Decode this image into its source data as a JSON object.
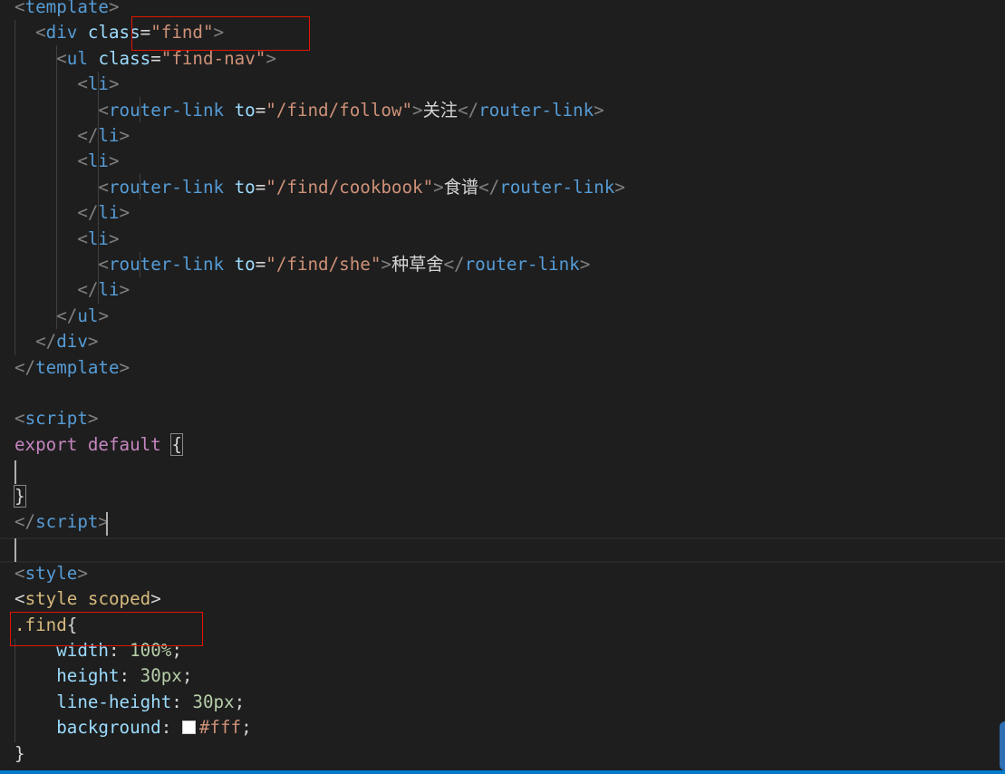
{
  "editor": {
    "language": "vue",
    "theme_colors": {
      "background": "#1e1e1e",
      "tag": "#569cd6",
      "attribute": "#9cdcfe",
      "string": "#ce9178",
      "keyword": "#c586c0",
      "selector": "#d7ba7d",
      "number": "#b5cea8",
      "highlight_box": "#e51400",
      "status_bar": "#007acc"
    },
    "lines": [
      {
        "segments": [
          {
            "t": "<",
            "c": "bracket"
          },
          {
            "t": "template",
            "c": "tag"
          },
          {
            "t": ">",
            "c": "bracket"
          }
        ]
      },
      {
        "segments": [
          {
            "t": "  "
          },
          {
            "t": "<",
            "c": "bracket"
          },
          {
            "t": "div",
            "c": "tag"
          },
          {
            "t": " "
          },
          {
            "t": "class",
            "c": "attr"
          },
          {
            "t": "=",
            "c": "text"
          },
          {
            "t": "\"find\"",
            "c": "str"
          },
          {
            "t": ">",
            "c": "bracket"
          }
        ]
      },
      {
        "segments": [
          {
            "t": "    "
          },
          {
            "t": "<",
            "c": "bracket"
          },
          {
            "t": "ul",
            "c": "tag"
          },
          {
            "t": " "
          },
          {
            "t": "class",
            "c": "attr"
          },
          {
            "t": "=",
            "c": "text"
          },
          {
            "t": "\"find-nav\"",
            "c": "str"
          },
          {
            "t": ">",
            "c": "bracket"
          }
        ]
      },
      {
        "segments": [
          {
            "t": "      "
          },
          {
            "t": "<",
            "c": "bracket"
          },
          {
            "t": "li",
            "c": "tag"
          },
          {
            "t": ">",
            "c": "bracket"
          }
        ]
      },
      {
        "segments": [
          {
            "t": "        "
          },
          {
            "t": "<",
            "c": "bracket"
          },
          {
            "t": "router-link",
            "c": "tag"
          },
          {
            "t": " "
          },
          {
            "t": "to",
            "c": "attr"
          },
          {
            "t": "=",
            "c": "text"
          },
          {
            "t": "\"/find/follow\"",
            "c": "str"
          },
          {
            "t": ">",
            "c": "bracket"
          },
          {
            "t": "关注",
            "c": "text"
          },
          {
            "t": "</",
            "c": "bracket"
          },
          {
            "t": "router-link",
            "c": "tag"
          },
          {
            "t": ">",
            "c": "bracket"
          }
        ]
      },
      {
        "segments": [
          {
            "t": "      "
          },
          {
            "t": "</",
            "c": "bracket"
          },
          {
            "t": "li",
            "c": "tag"
          },
          {
            "t": ">",
            "c": "bracket"
          }
        ]
      },
      {
        "segments": [
          {
            "t": "      "
          },
          {
            "t": "<",
            "c": "bracket"
          },
          {
            "t": "li",
            "c": "tag"
          },
          {
            "t": ">",
            "c": "bracket"
          }
        ]
      },
      {
        "segments": [
          {
            "t": "        "
          },
          {
            "t": "<",
            "c": "bracket"
          },
          {
            "t": "router-link",
            "c": "tag"
          },
          {
            "t": " "
          },
          {
            "t": "to",
            "c": "attr"
          },
          {
            "t": "=",
            "c": "text"
          },
          {
            "t": "\"/find/cookbook\"",
            "c": "str"
          },
          {
            "t": ">",
            "c": "bracket"
          },
          {
            "t": "食谱",
            "c": "text"
          },
          {
            "t": "</",
            "c": "bracket"
          },
          {
            "t": "router-link",
            "c": "tag"
          },
          {
            "t": ">",
            "c": "bracket"
          }
        ]
      },
      {
        "segments": [
          {
            "t": "      "
          },
          {
            "t": "</",
            "c": "bracket"
          },
          {
            "t": "li",
            "c": "tag"
          },
          {
            "t": ">",
            "c": "bracket"
          }
        ]
      },
      {
        "segments": [
          {
            "t": "      "
          },
          {
            "t": "<",
            "c": "bracket"
          },
          {
            "t": "li",
            "c": "tag"
          },
          {
            "t": ">",
            "c": "bracket"
          }
        ]
      },
      {
        "segments": [
          {
            "t": "        "
          },
          {
            "t": "<",
            "c": "bracket"
          },
          {
            "t": "router-link",
            "c": "tag"
          },
          {
            "t": " "
          },
          {
            "t": "to",
            "c": "attr"
          },
          {
            "t": "=",
            "c": "text"
          },
          {
            "t": "\"/find/she\"",
            "c": "str"
          },
          {
            "t": ">",
            "c": "bracket"
          },
          {
            "t": "种草舍",
            "c": "text"
          },
          {
            "t": "</",
            "c": "bracket"
          },
          {
            "t": "router-link",
            "c": "tag"
          },
          {
            "t": ">",
            "c": "bracket"
          }
        ]
      },
      {
        "segments": [
          {
            "t": "      "
          },
          {
            "t": "</",
            "c": "bracket"
          },
          {
            "t": "li",
            "c": "tag"
          },
          {
            "t": ">",
            "c": "bracket"
          }
        ]
      },
      {
        "segments": [
          {
            "t": "    "
          },
          {
            "t": "</",
            "c": "bracket"
          },
          {
            "t": "ul",
            "c": "tag"
          },
          {
            "t": ">",
            "c": "bracket"
          }
        ]
      },
      {
        "segments": [
          {
            "t": "  "
          },
          {
            "t": "</",
            "c": "bracket"
          },
          {
            "t": "div",
            "c": "tag"
          },
          {
            "t": ">",
            "c": "bracket"
          }
        ]
      },
      {
        "segments": [
          {
            "t": "</",
            "c": "bracket"
          },
          {
            "t": "template",
            "c": "tag"
          },
          {
            "t": ">",
            "c": "bracket"
          }
        ]
      },
      {
        "segments": []
      },
      {
        "segments": [
          {
            "t": "<",
            "c": "bracket"
          },
          {
            "t": "script",
            "c": "tag"
          },
          {
            "t": ">",
            "c": "bracket"
          }
        ]
      },
      {
        "segments": [
          {
            "t": "export",
            "c": "kw"
          },
          {
            "t": " "
          },
          {
            "t": "default",
            "c": "kw"
          },
          {
            "t": " "
          },
          {
            "t": "{",
            "c": "text",
            "box": true
          }
        ]
      },
      {
        "segments": []
      },
      {
        "segments": [
          {
            "t": "}",
            "c": "text",
            "box": true
          }
        ]
      },
      {
        "segments": [
          {
            "t": "</",
            "c": "bracket"
          },
          {
            "t": "script",
            "c": "tag"
          },
          {
            "t": ">",
            "c": "bracket"
          }
        ]
      },
      {
        "segments": []
      },
      {
        "segments": [
          {
            "t": "<",
            "c": "bracket"
          },
          {
            "t": "style",
            "c": "tag"
          },
          {
            "t": ">",
            "c": "bracket"
          }
        ]
      },
      {
        "segments": [
          {
            "t": "<",
            "c": "text"
          },
          {
            "t": "style",
            "c": "sel"
          },
          {
            "t": " "
          },
          {
            "t": "scoped",
            "c": "sel"
          },
          {
            "t": ">",
            "c": "text"
          }
        ]
      },
      {
        "segments": [
          {
            "t": ".find",
            "c": "sel"
          },
          {
            "t": "{",
            "c": "text"
          }
        ]
      },
      {
        "segments": [
          {
            "t": "    "
          },
          {
            "t": "width",
            "c": "prop"
          },
          {
            "t": ": ",
            "c": "text"
          },
          {
            "t": "100%",
            "c": "num"
          },
          {
            "t": ";",
            "c": "text"
          }
        ]
      },
      {
        "segments": [
          {
            "t": "    "
          },
          {
            "t": "height",
            "c": "prop"
          },
          {
            "t": ": ",
            "c": "text"
          },
          {
            "t": "30px",
            "c": "num"
          },
          {
            "t": ";",
            "c": "text"
          }
        ]
      },
      {
        "segments": [
          {
            "t": "    "
          },
          {
            "t": "line-height",
            "c": "prop"
          },
          {
            "t": ": ",
            "c": "text"
          },
          {
            "t": "30px",
            "c": "num"
          },
          {
            "t": ";",
            "c": "text"
          }
        ]
      },
      {
        "segments": [
          {
            "t": "    "
          },
          {
            "t": "background",
            "c": "prop"
          },
          {
            "t": ": ",
            "c": "text"
          },
          {
            "t": "",
            "c": "swatch"
          },
          {
            "t": "#fff",
            "c": "cval"
          },
          {
            "t": ";",
            "c": "text"
          }
        ]
      },
      {
        "segments": [
          {
            "t": "}",
            "c": "text"
          }
        ]
      }
    ]
  }
}
